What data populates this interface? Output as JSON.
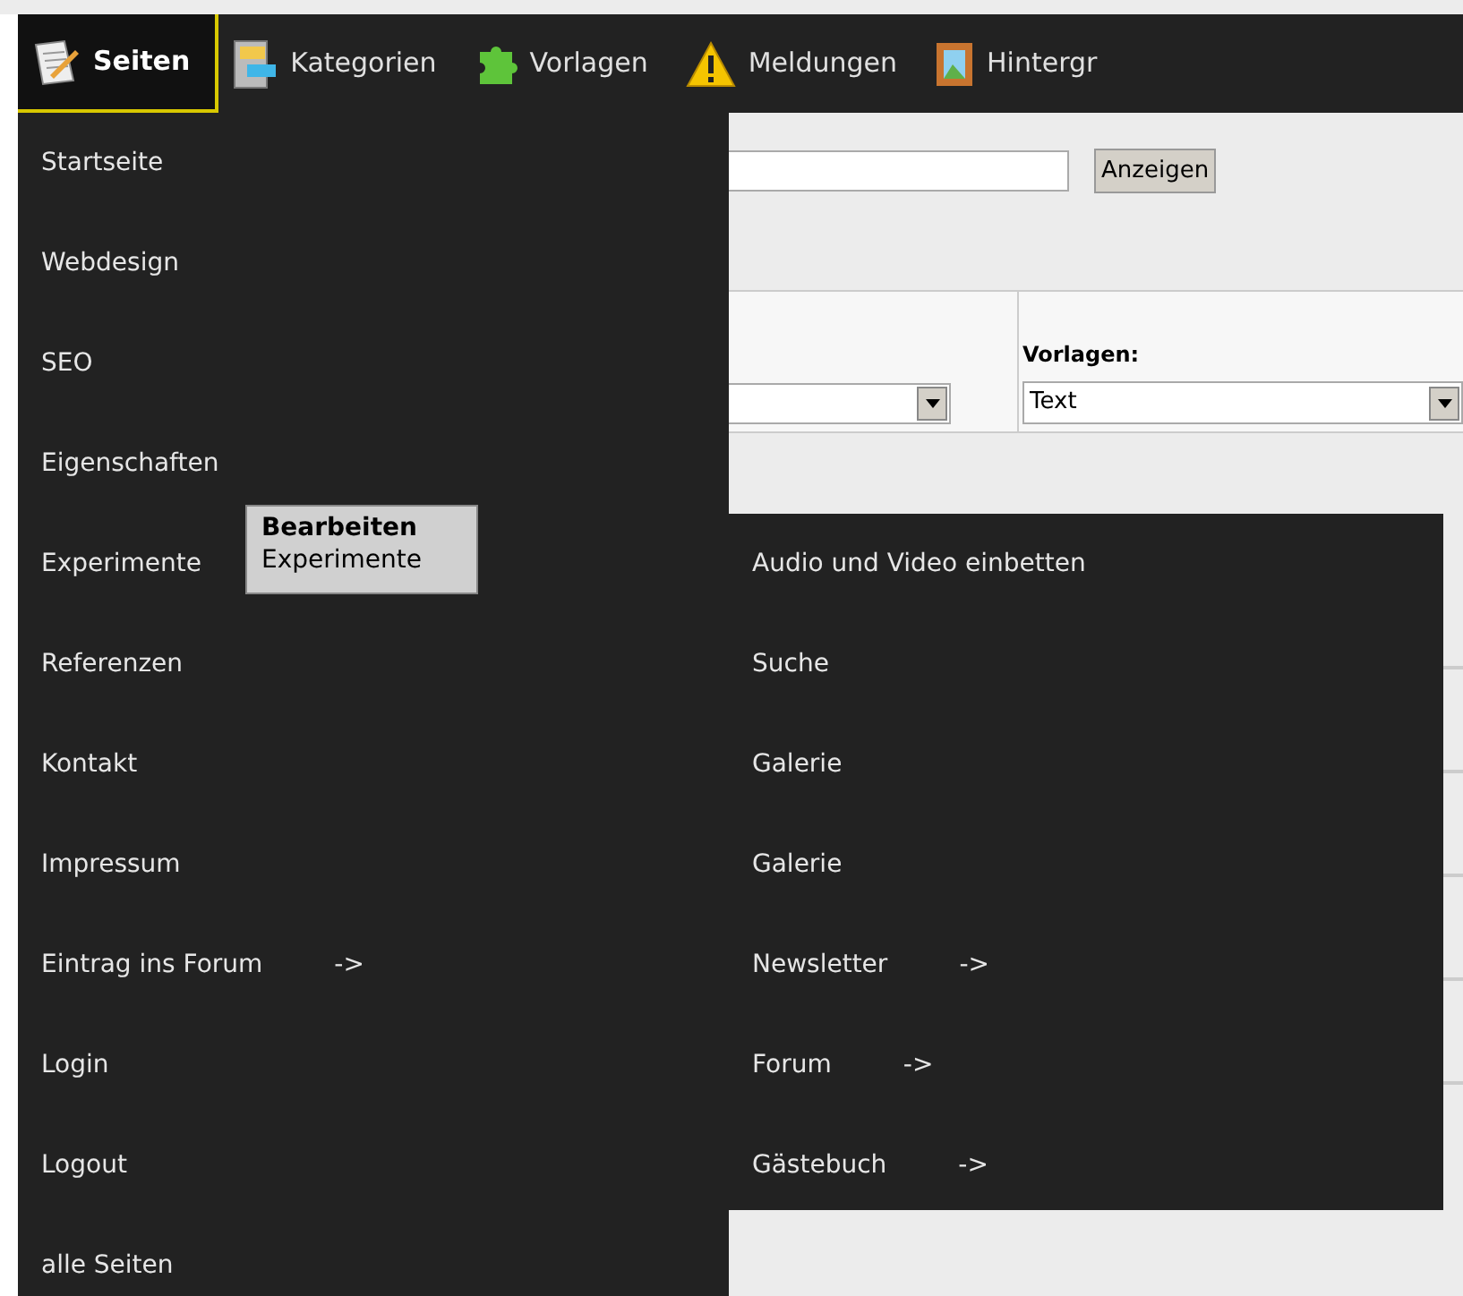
{
  "nav": [
    {
      "label": "Seiten",
      "selected": true
    },
    {
      "label": "Kategorien",
      "selected": false
    },
    {
      "label": "Vorlagen",
      "selected": false
    },
    {
      "label": "Meldungen",
      "selected": false
    },
    {
      "label": "Hintergr",
      "selected": false
    }
  ],
  "form": {
    "button": "Anzeigen",
    "template_label": "Vorlagen:",
    "template_value": "Text"
  },
  "menu": [
    {
      "label": "Startseite"
    },
    {
      "label": "Webdesign"
    },
    {
      "label": "SEO"
    },
    {
      "label": "Eigenschaften"
    },
    {
      "label": "Experimente"
    },
    {
      "label": "Referenzen"
    },
    {
      "label": "Kontakt"
    },
    {
      "label": "Impressum"
    },
    {
      "label": "Eintrag ins Forum",
      "arrow": "->"
    },
    {
      "label": "Login"
    },
    {
      "label": "Logout"
    },
    {
      "label": "alle Seiten"
    }
  ],
  "tooltip": {
    "title": "Bearbeiten",
    "text": "Experimente"
  },
  "submenu": [
    {
      "label": "Audio und Video einbetten"
    },
    {
      "label": "Suche"
    },
    {
      "label": "Galerie"
    },
    {
      "label": "Galerie"
    },
    {
      "label": "Newsletter",
      "arrow": "->"
    },
    {
      "label": "Forum",
      "arrow": "->"
    },
    {
      "label": "Gästebuch",
      "arrow": "->"
    }
  ]
}
